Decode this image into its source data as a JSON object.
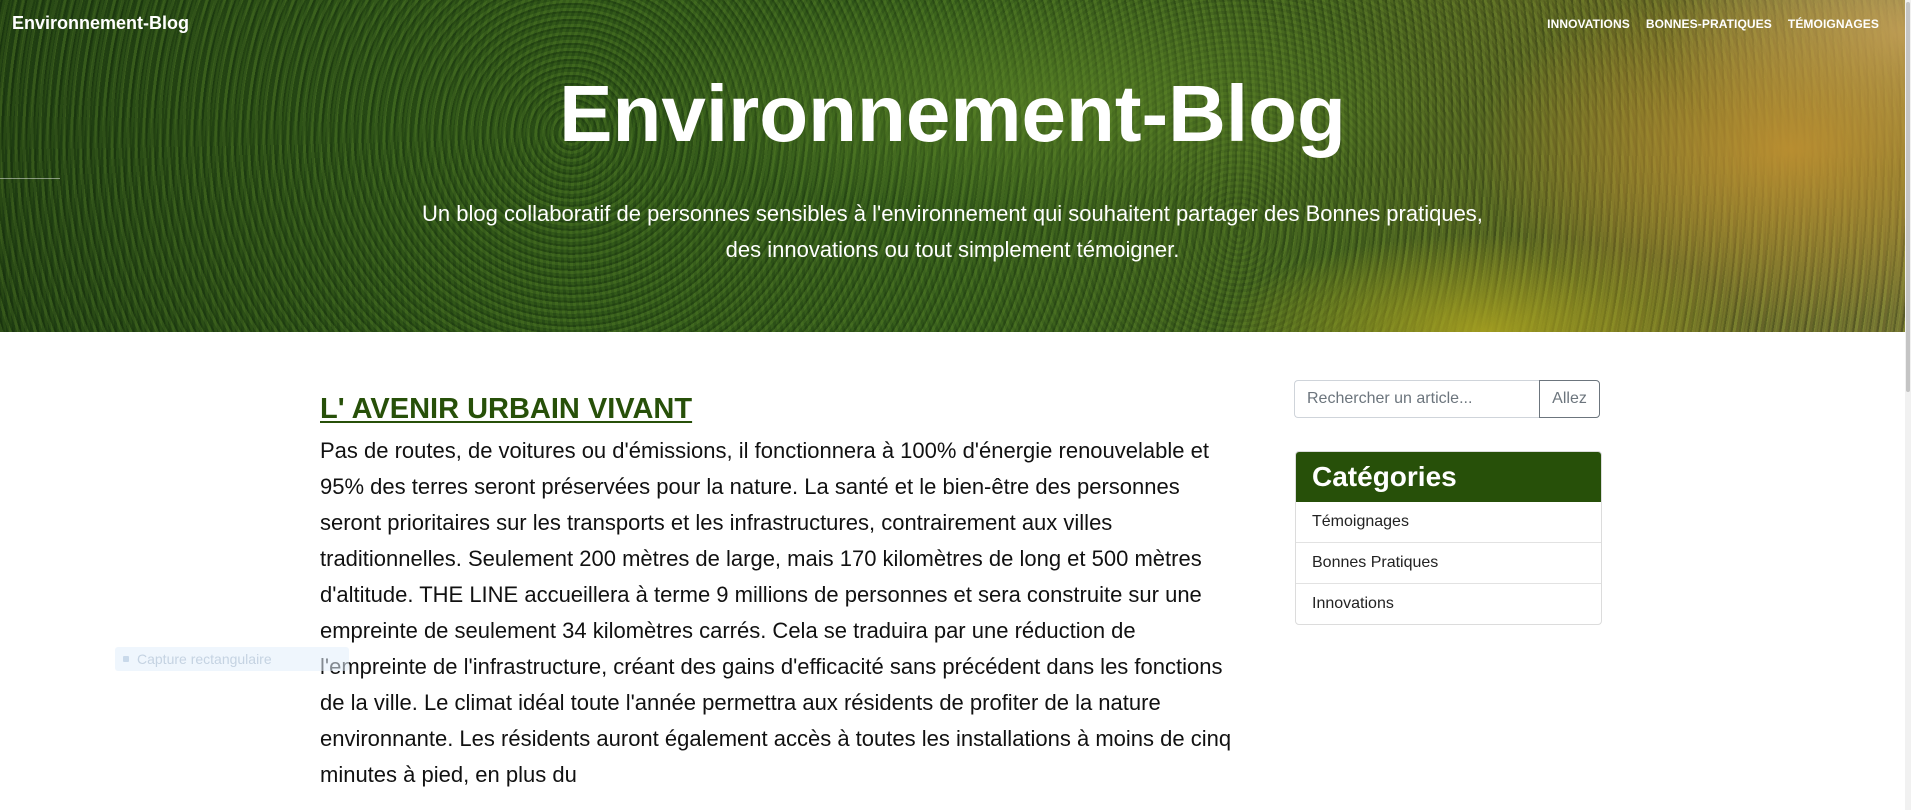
{
  "navbar": {
    "brand": "Environnement-Blog",
    "links": [
      "INNOVATIONS",
      "BONNES-PRATIQUES",
      "TÉMOIGNAGES"
    ]
  },
  "hero": {
    "title": "Environnement-Blog",
    "subtitle": "Un blog collaboratif de personnes sensibles à l'environnement qui souhaitent partager des Bonnes pratiques, des innovations ou tout simplement témoigner."
  },
  "article": {
    "title": "L' AVENIR URBAIN VIVANT",
    "body": "Pas de routes, de voitures ou d'émissions, il fonctionnera à 100% d'énergie renouvelable et 95% des terres seront préservées pour la nature. La santé et le bien-être des personnes seront prioritaires sur les transports et les infrastructures, contrairement aux villes traditionnelles. Seulement 200 mètres de large, mais 170 kilomètres de long et 500 mètres d'altitude. THE LINE accueillera à terme 9 millions de personnes et sera construite sur une empreinte de seulement 34 kilomètres carrés. Cela se traduira par une réduction de l'empreinte de l'infrastructure, créant des gains d'efficacité sans précédent dans les fonctions de la ville. Le climat idéal toute l'année permettra aux résidents de profiter de la nature environnante. Les résidents auront également accès à toutes les installations à moins de cinq minutes à pied, en plus du"
  },
  "search": {
    "placeholder": "Rechercher un article...",
    "button": "Allez"
  },
  "categories": {
    "title": "Catégories",
    "items": [
      "Témoignages",
      "Bonnes Pratiques",
      "Innovations"
    ]
  },
  "overlay": {
    "label": "Capture rectangulaire"
  },
  "colors": {
    "accent_green": "#275009"
  }
}
